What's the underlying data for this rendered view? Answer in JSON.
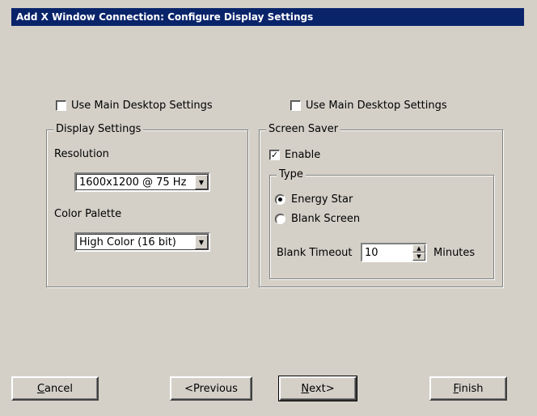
{
  "window": {
    "title": "Add X Window Connection: Configure Display Settings"
  },
  "left": {
    "use_main_label": "Use Main Desktop Settings",
    "use_main_checked": false,
    "group_label": "Display Settings",
    "resolution_label": "Resolution",
    "resolution_value": "1600x1200 @ 75 Hz",
    "palette_label": "Color Palette",
    "palette_value": "High Color (16 bit)"
  },
  "right": {
    "use_main_label": "Use Main Desktop Settings",
    "use_main_checked": false,
    "group_label": "Screen Saver",
    "enable_label": "Enable",
    "enable_checked": true,
    "type_group_label": "Type",
    "radio_energy_label": "Energy Star",
    "radio_blank_label": "Blank Screen",
    "selected_type": "Energy Star",
    "timeout_label": "Blank Timeout",
    "timeout_value": "10",
    "timeout_units": "Minutes"
  },
  "buttons": {
    "cancel": "Cancel",
    "previous": "<Previous",
    "next": "Next>",
    "finish": "Finish"
  },
  "colors": {
    "titlebar": "#0a246a",
    "face": "#d4d0c8"
  }
}
